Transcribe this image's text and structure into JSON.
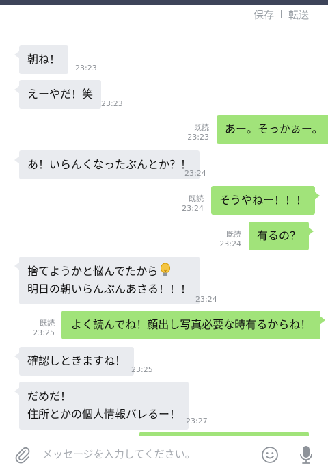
{
  "header": {
    "save_label": "保存",
    "forward_label": "転送"
  },
  "messages": [
    {
      "dir": "in",
      "text": "朝ね！",
      "time": "23:23"
    },
    {
      "dir": "in",
      "text": "えーやだ！笑",
      "time": "23:23"
    },
    {
      "dir": "out",
      "text": "あー。そっかぁー。",
      "read": "既読",
      "time": "23:23"
    },
    {
      "dir": "in",
      "text": "あ！いらんくなったぶんとか？！",
      "time": "23:24"
    },
    {
      "dir": "out",
      "text": "そうやねー！！！",
      "read": "既読",
      "time": "23:24"
    },
    {
      "dir": "out",
      "text": "有るの？",
      "read": "既読",
      "time": "23:24"
    },
    {
      "dir": "in",
      "line1": "捨てようかと悩んでたから",
      "icon": "lightbulb-icon",
      "line2": "明日の朝いらんぶんあさる！！！",
      "time": "23:24"
    },
    {
      "dir": "out",
      "text": "よく読んでね！顔出し写真必要な時有るからね！",
      "read": "既読",
      "time": "23:25"
    },
    {
      "dir": "in",
      "text": "確認しときますね！",
      "time": "23:25"
    },
    {
      "dir": "in",
      "line1": "だめだ！",
      "line2": "住所とかの個人情報バレるー！",
      "time": "23:27"
    }
  ],
  "input": {
    "placeholder": "メッセージを入力してください。"
  },
  "colors": {
    "incoming_bubble": "#e9ebef",
    "outgoing_bubble": "#a1e37a",
    "top_bar": "#3d4459"
  }
}
